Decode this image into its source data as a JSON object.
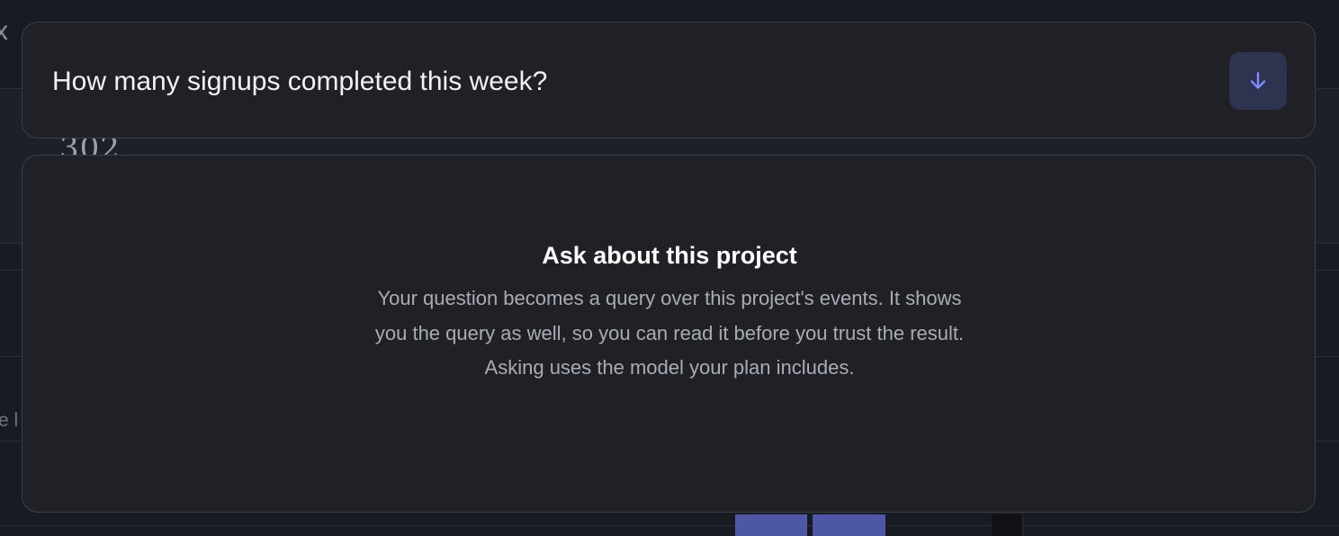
{
  "ask": {
    "question_value": "How many signups completed this week?",
    "submit_icon": "arrow-down-icon"
  },
  "panel": {
    "title": "Ask about this project",
    "body": "Your question becomes a query over this project's events. It shows you the query as well, so you can read it before you trust the result. Asking uses the model your plan includes."
  },
  "background": {
    "close_glyph": "x",
    "stat_value": "302",
    "edge_text": "e l"
  },
  "colors": {
    "page_bg": "#181b22",
    "card_bg": "#1f2127",
    "card_border": "#3b3e45",
    "accent": "#7f8bff",
    "submit_bg": "#2e3350",
    "bar": "#4e57a6"
  }
}
